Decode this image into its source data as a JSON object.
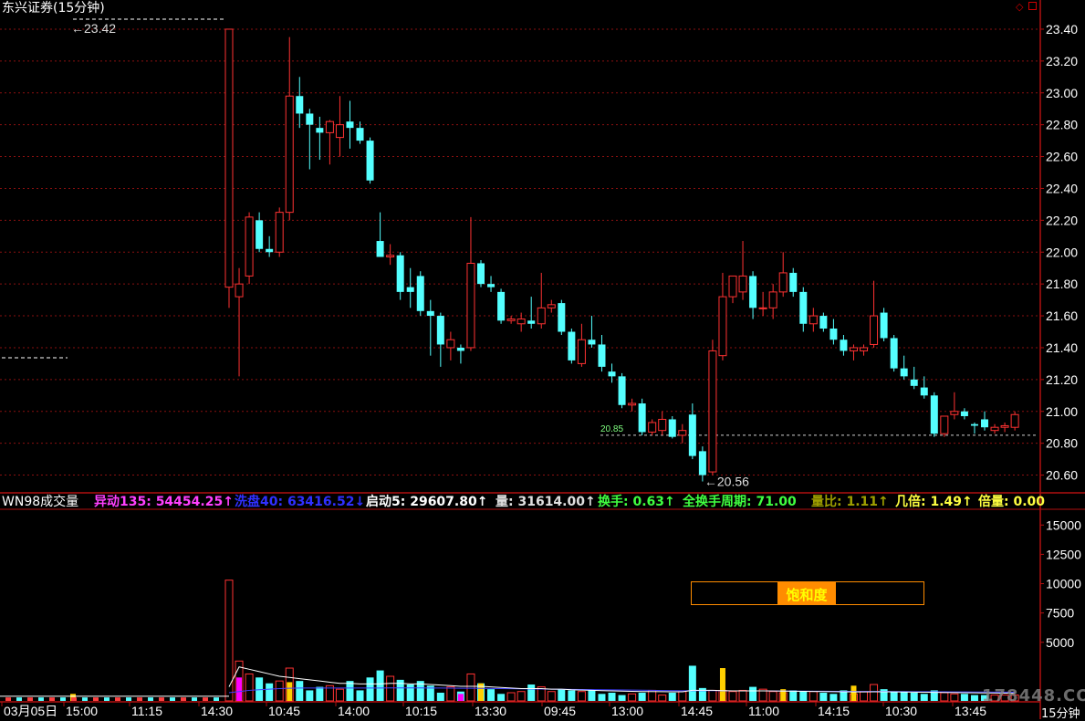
{
  "title": "东兴证券(15分钟)",
  "period_label": "15分钟",
  "watermark": "178448.COM",
  "corner_icon": "diamond-icon",
  "colors": {
    "up": "#ff3232",
    "down": "#54ffff",
    "grid": "#8a1010",
    "axis": "#b01010",
    "ma_vol_white": "#ffffff",
    "ma_vol_blue": "#4040ff",
    "support": "#cfcfcf"
  },
  "price_panel": {
    "ylim": [
      20.5,
      23.48
    ],
    "yticks": [
      "23.40",
      "23.20",
      "23.00",
      "22.80",
      "22.60",
      "22.40",
      "22.20",
      "22.00",
      "21.80",
      "21.60",
      "21.40",
      "21.20",
      "21.00",
      "20.80",
      "20.60"
    ],
    "high_label": "23.42",
    "low_label": "20.56",
    "support_value": "20.85",
    "support_level": 20.85
  },
  "indicator_line": {
    "name": "WN98成交量",
    "items": [
      {
        "text": "异动135: 54454.25↑",
        "color": "#ff40ff"
      },
      {
        "text": "洗盘40: 63416.52↓",
        "color": "#3030ff"
      },
      {
        "text": "启动5: 29607.80↑",
        "color": "#ffffff"
      },
      {
        "text": "量: 31614.00↑",
        "color": "#e0e0e0"
      },
      {
        "text": "换手: 0.63↑",
        "color": "#40ff40"
      },
      {
        "text": "全换手周期: 71.00",
        "color": "#40ff40"
      },
      {
        "text": "量比: 1.11↑",
        "color": "#a0a000"
      },
      {
        "text": "几倍: 1.49↑",
        "color": "#ffff40"
      },
      {
        "text": "倍量: 0.00",
        "color": "#ffff40"
      }
    ]
  },
  "volume_panel": {
    "ylim": [
      0,
      16500
    ],
    "yticks": [
      "15000",
      "12500",
      "10000",
      "7500",
      "5000"
    ],
    "saturation_label": "饱和度",
    "saturation_fraction": 0.6
  },
  "x_labels": [
    "03月05日",
    "15:00",
    "11:15",
    "14:30",
    "10:45",
    "14:00",
    "10:15",
    "13:30",
    "09:45",
    "13:00",
    "14:45",
    "11:00",
    "14:15",
    "10:30",
    "13:45"
  ],
  "chart_data": {
    "type": "candlestick",
    "candles": [
      {
        "o": 21.78,
        "h": 23.4,
        "l": 21.65,
        "c": 23.4
      },
      {
        "o": 21.72,
        "h": 21.9,
        "l": 21.22,
        "c": 21.8
      },
      {
        "o": 21.85,
        "h": 22.25,
        "l": 21.8,
        "c": 22.22
      },
      {
        "o": 22.2,
        "h": 22.25,
        "l": 22.0,
        "c": 22.02
      },
      {
        "o": 22.02,
        "h": 22.1,
        "l": 21.97,
        "c": 22.0
      },
      {
        "o": 22.0,
        "h": 22.28,
        "l": 21.97,
        "c": 22.25
      },
      {
        "o": 22.25,
        "h": 23.35,
        "l": 22.2,
        "c": 22.98
      },
      {
        "o": 22.98,
        "h": 23.1,
        "l": 22.78,
        "c": 22.87
      },
      {
        "o": 22.87,
        "h": 22.9,
        "l": 22.52,
        "c": 22.8
      },
      {
        "o": 22.78,
        "h": 22.85,
        "l": 22.58,
        "c": 22.75
      },
      {
        "o": 22.75,
        "h": 22.83,
        "l": 22.55,
        "c": 22.82
      },
      {
        "o": 22.72,
        "h": 22.98,
        "l": 22.6,
        "c": 22.8
      },
      {
        "o": 22.82,
        "h": 22.95,
        "l": 22.65,
        "c": 22.78
      },
      {
        "o": 22.78,
        "h": 22.82,
        "l": 22.68,
        "c": 22.7
      },
      {
        "o": 22.7,
        "h": 22.72,
        "l": 22.43,
        "c": 22.45
      },
      {
        "o": 22.07,
        "h": 22.25,
        "l": 21.98,
        "c": 21.97
      },
      {
        "o": 21.97,
        "h": 22.05,
        "l": 21.92,
        "c": 21.98
      },
      {
        "o": 21.98,
        "h": 22.0,
        "l": 21.7,
        "c": 21.75
      },
      {
        "o": 21.78,
        "h": 21.9,
        "l": 21.65,
        "c": 21.75
      },
      {
        "o": 21.85,
        "h": 21.88,
        "l": 21.6,
        "c": 21.63
      },
      {
        "o": 21.63,
        "h": 21.7,
        "l": 21.35,
        "c": 21.6
      },
      {
        "o": 21.6,
        "h": 21.62,
        "l": 21.28,
        "c": 21.42
      },
      {
        "o": 21.4,
        "h": 21.5,
        "l": 21.32,
        "c": 21.45
      },
      {
        "o": 21.4,
        "h": 21.42,
        "l": 21.3,
        "c": 21.38
      },
      {
        "o": 21.4,
        "h": 22.22,
        "l": 21.38,
        "c": 21.93
      },
      {
        "o": 21.93,
        "h": 21.95,
        "l": 21.78,
        "c": 21.8
      },
      {
        "o": 21.8,
        "h": 21.85,
        "l": 21.75,
        "c": 21.78
      },
      {
        "o": 21.75,
        "h": 21.77,
        "l": 21.55,
        "c": 21.57
      },
      {
        "o": 21.57,
        "h": 21.6,
        "l": 21.55,
        "c": 21.58
      },
      {
        "o": 21.55,
        "h": 21.62,
        "l": 21.5,
        "c": 21.58
      },
      {
        "o": 21.57,
        "h": 21.72,
        "l": 21.52,
        "c": 21.55
      },
      {
        "o": 21.55,
        "h": 21.87,
        "l": 21.52,
        "c": 21.65
      },
      {
        "o": 21.65,
        "h": 21.7,
        "l": 21.62,
        "c": 21.67
      },
      {
        "o": 21.68,
        "h": 21.7,
        "l": 21.48,
        "c": 21.5
      },
      {
        "o": 21.5,
        "h": 21.52,
        "l": 21.3,
        "c": 21.32
      },
      {
        "o": 21.3,
        "h": 21.55,
        "l": 21.28,
        "c": 21.45
      },
      {
        "o": 21.45,
        "h": 21.6,
        "l": 21.4,
        "c": 21.42
      },
      {
        "o": 21.42,
        "h": 21.48,
        "l": 21.25,
        "c": 21.28
      },
      {
        "o": 21.25,
        "h": 21.3,
        "l": 21.18,
        "c": 21.22
      },
      {
        "o": 21.22,
        "h": 21.24,
        "l": 21.02,
        "c": 21.04
      },
      {
        "o": 21.04,
        "h": 21.08,
        "l": 21.0,
        "c": 21.05
      },
      {
        "o": 21.05,
        "h": 21.08,
        "l": 20.85,
        "c": 20.87
      },
      {
        "o": 20.87,
        "h": 20.95,
        "l": 20.85,
        "c": 20.93
      },
      {
        "o": 20.88,
        "h": 21.0,
        "l": 20.85,
        "c": 20.95
      },
      {
        "o": 20.95,
        "h": 20.97,
        "l": 20.83,
        "c": 20.84
      },
      {
        "o": 20.85,
        "h": 20.92,
        "l": 20.8,
        "c": 20.88
      },
      {
        "o": 20.98,
        "h": 21.05,
        "l": 20.7,
        "c": 20.72
      },
      {
        "o": 20.75,
        "h": 20.78,
        "l": 20.56,
        "c": 20.6
      },
      {
        "o": 20.62,
        "h": 21.45,
        "l": 20.6,
        "c": 21.38
      },
      {
        "o": 21.35,
        "h": 21.87,
        "l": 21.32,
        "c": 21.72
      },
      {
        "o": 21.72,
        "h": 21.85,
        "l": 21.68,
        "c": 21.85
      },
      {
        "o": 21.75,
        "h": 22.07,
        "l": 21.7,
        "c": 21.85
      },
      {
        "o": 21.85,
        "h": 21.88,
        "l": 21.58,
        "c": 21.65
      },
      {
        "o": 21.65,
        "h": 21.75,
        "l": 21.6,
        "c": 21.65
      },
      {
        "o": 21.65,
        "h": 21.8,
        "l": 21.58,
        "c": 21.75
      },
      {
        "o": 21.75,
        "h": 22.0,
        "l": 21.72,
        "c": 21.87
      },
      {
        "o": 21.87,
        "h": 21.9,
        "l": 21.72,
        "c": 21.75
      },
      {
        "o": 21.75,
        "h": 21.78,
        "l": 21.5,
        "c": 21.55
      },
      {
        "o": 21.55,
        "h": 21.65,
        "l": 21.5,
        "c": 21.6
      },
      {
        "o": 21.6,
        "h": 21.62,
        "l": 21.5,
        "c": 21.52
      },
      {
        "o": 21.52,
        "h": 21.58,
        "l": 21.42,
        "c": 21.45
      },
      {
        "o": 21.45,
        "h": 21.48,
        "l": 21.35,
        "c": 21.38
      },
      {
        "o": 21.38,
        "h": 21.42,
        "l": 21.32,
        "c": 21.4
      },
      {
        "o": 21.38,
        "h": 21.42,
        "l": 21.35,
        "c": 21.4
      },
      {
        "o": 21.42,
        "h": 21.82,
        "l": 21.4,
        "c": 21.6
      },
      {
        "o": 21.62,
        "h": 21.65,
        "l": 21.44,
        "c": 21.46
      },
      {
        "o": 21.46,
        "h": 21.48,
        "l": 21.25,
        "c": 21.27
      },
      {
        "o": 21.27,
        "h": 21.35,
        "l": 21.2,
        "c": 21.22
      },
      {
        "o": 21.2,
        "h": 21.28,
        "l": 21.14,
        "c": 21.16
      },
      {
        "o": 21.15,
        "h": 21.22,
        "l": 21.08,
        "c": 21.1
      },
      {
        "o": 21.1,
        "h": 21.12,
        "l": 20.84,
        "c": 20.86
      },
      {
        "o": 20.86,
        "h": 20.9,
        "l": 20.84,
        "c": 20.97
      },
      {
        "o": 20.98,
        "h": 21.12,
        "l": 20.95,
        "c": 21.0
      },
      {
        "o": 21.0,
        "h": 21.02,
        "l": 20.95,
        "c": 20.97
      },
      {
        "o": 20.92,
        "h": 20.93,
        "l": 20.86,
        "c": 20.91
      },
      {
        "o": 20.95,
        "h": 21.0,
        "l": 20.88,
        "c": 20.9
      },
      {
        "o": 20.88,
        "h": 20.92,
        "l": 20.86,
        "c": 20.9
      },
      {
        "o": 20.9,
        "h": 20.93,
        "l": 20.87,
        "c": 20.91
      },
      {
        "o": 20.9,
        "h": 21.0,
        "l": 20.88,
        "c": 20.98
      }
    ],
    "volumes": [
      10300,
      3400,
      2300,
      2000,
      1500,
      1700,
      2800,
      1700,
      900,
      1200,
      1300,
      1000,
      1700,
      900,
      2000,
      2600,
      2100,
      1800,
      1400,
      1700,
      1300,
      700,
      1200,
      800,
      2300,
      1500,
      1000,
      600,
      700,
      800,
      1400,
      1200,
      800,
      1000,
      900,
      800,
      900,
      600,
      700,
      500,
      600,
      700,
      900,
      500,
      700,
      800,
      3000,
      1100,
      900,
      900,
      800,
      900,
      1200,
      1000,
      800,
      700,
      900,
      800,
      800,
      700,
      600,
      900,
      600,
      800,
      1400,
      1000,
      800,
      800,
      700,
      600,
      900,
      700,
      600,
      600,
      500,
      500,
      500,
      500,
      500
    ],
    "volume_ma_white": [
      1200,
      2900,
      2700,
      2500,
      2300,
      2100,
      2000,
      1900,
      1800,
      1700,
      1600,
      1500,
      1500,
      1450,
      1450,
      1450,
      1500,
      1500,
      1450,
      1450,
      1400,
      1350,
      1300,
      1250,
      1250,
      1250,
      1200,
      1150,
      1100,
      1050,
      1050,
      1050,
      1000,
      1000,
      950,
      920,
      900,
      880,
      860,
      840,
      820,
      800,
      800,
      790,
      780,
      780,
      900,
      900,
      900,
      880,
      860,
      860,
      860,
      860,
      850,
      840,
      830,
      820,
      810,
      800,
      790,
      780,
      770,
      770,
      780,
      780,
      770,
      760,
      750,
      740,
      730,
      720,
      710,
      700,
      690,
      680,
      670,
      660,
      650
    ],
    "volume_ma_blue": [
      700,
      800,
      900,
      950,
      1000,
      1050,
      1080,
      1100,
      1100,
      1100,
      1100,
      1100,
      1100,
      1100,
      1100,
      1100,
      1110,
      1110,
      1110,
      1110,
      1100,
      1100,
      1090,
      1080,
      1080,
      1070,
      1060,
      1050,
      1040,
      1030,
      1020,
      1010,
      1000,
      990,
      980,
      970,
      960,
      950,
      940,
      930,
      920,
      910,
      900,
      890,
      880,
      870,
      880,
      880,
      880,
      870,
      860,
      860,
      860,
      860,
      850,
      850,
      840,
      840,
      830,
      830,
      820,
      820,
      810,
      810,
      810,
      810,
      800,
      800,
      790,
      790,
      780,
      780,
      770,
      770,
      760,
      760,
      750,
      750,
      740
    ]
  }
}
